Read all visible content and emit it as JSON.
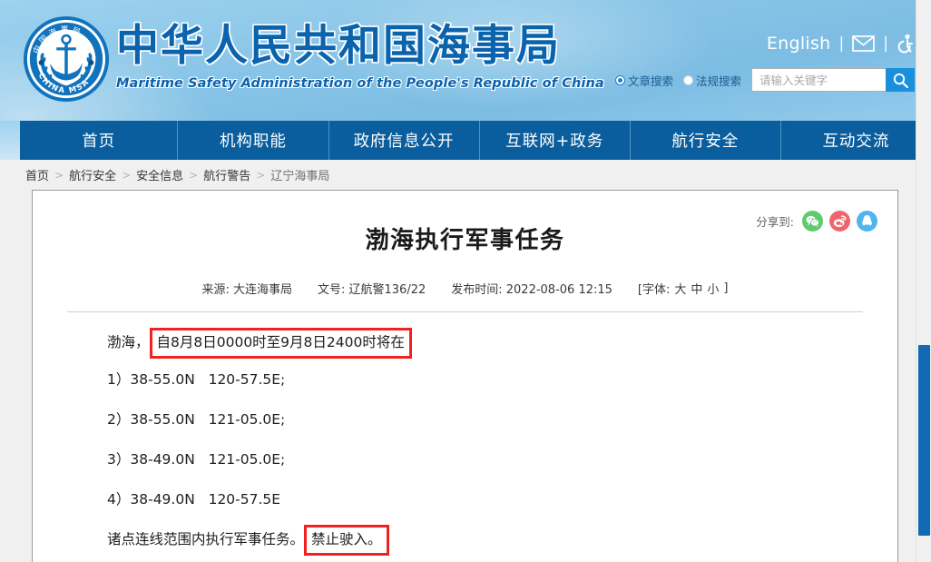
{
  "header": {
    "brand_cn": "中华人民共和国海事局",
    "brand_en": "Maritime Safety Administration of the People's Republic of China",
    "logo_alt": "china-msa-emblem",
    "english_label": "English",
    "separator": "|",
    "mail_icon": "envelope-icon",
    "accessibility_icon": "accessibility-icon",
    "search": {
      "radio_article": "文章搜索",
      "radio_regulation": "法规搜索",
      "selected": "文章搜索",
      "placeholder": "请输入关键字",
      "value": "",
      "button_icon": "search-icon"
    }
  },
  "nav": {
    "items": [
      {
        "label": "首页"
      },
      {
        "label": "机构职能"
      },
      {
        "label": "政府信息公开"
      },
      {
        "label": "互联网+政务"
      },
      {
        "label": "航行安全"
      },
      {
        "label": "互动交流"
      }
    ]
  },
  "breadcrumb": {
    "separator": ">",
    "items": [
      {
        "label": "首页"
      },
      {
        "label": "航行安全"
      },
      {
        "label": "安全信息"
      },
      {
        "label": "航行警告"
      },
      {
        "label": "辽宁海事局"
      }
    ]
  },
  "share": {
    "label": "分享到:",
    "targets": [
      {
        "name": "wechat",
        "icon": "wechat-icon"
      },
      {
        "name": "weibo",
        "icon": "weibo-icon"
      },
      {
        "name": "qq",
        "icon": "qq-icon"
      }
    ]
  },
  "article": {
    "title": "渤海执行军事任务",
    "meta": {
      "source": "来源: 大连海事局",
      "doc_number": "文号: 辽航警136/22",
      "publish_time": "发布时间: 2022-08-06 12:15",
      "font_prefix": "[字体:",
      "font_large": "大",
      "font_medium": "中",
      "font_small": "小",
      "font_suffix": "]"
    },
    "body": {
      "lead_prefix": "渤海，",
      "lead_highlight": "自8月8日0000时至9月8日2400时将在",
      "coordinates": [
        {
          "index": "1）",
          "text": "38-55.0N   120-57.5E;"
        },
        {
          "index": "2）",
          "text": "38-55.0N   121-05.0E;"
        },
        {
          "index": "3）",
          "text": "38-49.0N   121-05.0E;"
        },
        {
          "index": "4）",
          "text": "38-49.0N   120-57.5E"
        }
      ],
      "closing_prefix": "诸点连线范围内执行军事任务。",
      "closing_highlight": "禁止驶入。"
    }
  },
  "colors": {
    "nav_blue": "#0a5e9e",
    "brand_blue": "#0a63ad",
    "accent_search": "#1a8fdc",
    "highlight_red": "#f42020",
    "scrollbar_thumb": "#1268b3"
  },
  "scrollbar": {
    "orientation": "vertical"
  }
}
